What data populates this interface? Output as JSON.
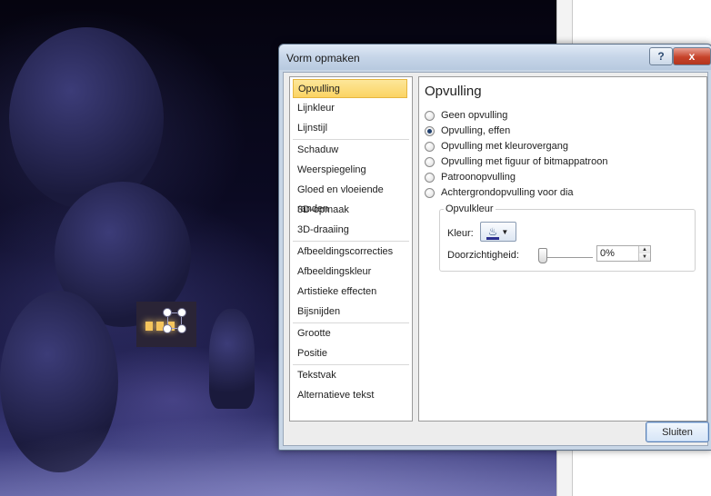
{
  "dialog": {
    "title": "Vorm opmaken",
    "help_label": "?",
    "close_label": "x",
    "close_button": "Sluiten"
  },
  "categories": [
    {
      "label": "Opvulling",
      "selected": true
    },
    {
      "label": "Lijnkleur"
    },
    {
      "label": "Lijnstijl"
    },
    {
      "label": "Schaduw"
    },
    {
      "label": "Weerspiegeling"
    },
    {
      "label": "Gloed en vloeiende randen"
    },
    {
      "label": "3D-opmaak"
    },
    {
      "label": "3D-draaiing"
    },
    {
      "label": "Afbeeldingscorrecties"
    },
    {
      "label": "Afbeeldingskleur"
    },
    {
      "label": "Artistieke effecten"
    },
    {
      "label": "Bijsnijden"
    },
    {
      "label": "Grootte"
    },
    {
      "label": "Positie"
    },
    {
      "label": "Tekstvak"
    },
    {
      "label": "Alternatieve tekst"
    }
  ],
  "panel": {
    "title": "Opvulling",
    "options": [
      {
        "label": "Geen opvulling",
        "checked": false
      },
      {
        "label": "Opvulling, effen",
        "checked": true
      },
      {
        "label": "Opvulling met kleurovergang",
        "checked": false
      },
      {
        "label": "Opvulling met figuur of bitmappatroon",
        "checked": false
      },
      {
        "label": "Patroonopvulling",
        "checked": false
      },
      {
        "label": "Achtergrondopvulling voor dia",
        "checked": false
      }
    ],
    "group": {
      "title": "Opvulkleur",
      "color_label": "Kleur:",
      "transparency_label": "Doorzichtigheid:",
      "transparency_value": "0%",
      "transparency_fraction": 0
    }
  },
  "icons": {
    "help": "help-icon",
    "close": "close-icon",
    "fill_color": "paint-bucket-icon",
    "dropdown": "chevron-down-icon"
  },
  "colors": {
    "selected_category": "#fbd363",
    "fill_color_swatch": "#2b2f8f",
    "close_titlebar": "#c7432a"
  }
}
